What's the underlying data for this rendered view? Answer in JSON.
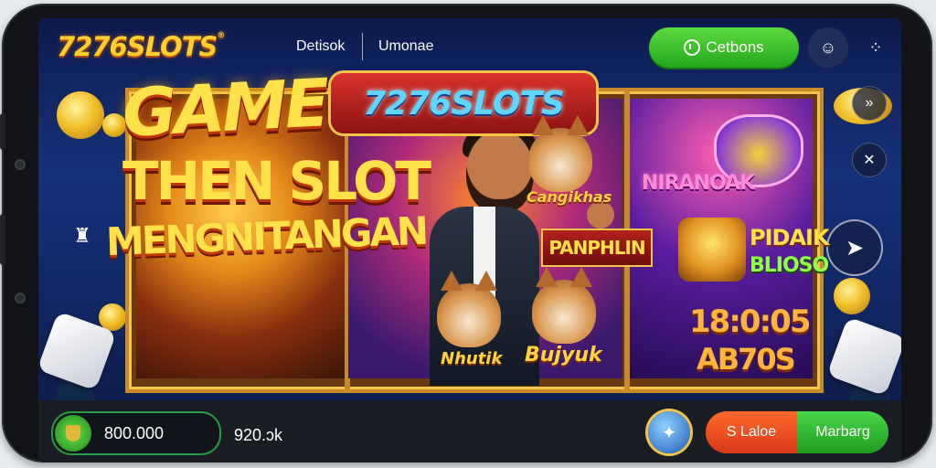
{
  "header": {
    "logo": "7276SLOTS",
    "logo_mark": "®",
    "nav": [
      "Detisok",
      "Umonae"
    ],
    "cta_label": "Cetbons",
    "icons": [
      "chat-icon",
      "grid-menu-icon"
    ]
  },
  "banner": {
    "logo": "7276SLOTS",
    "headline_line1": "GAME",
    "headline_line2": "THEN SLOT",
    "headline_line3": "MENGNITANGAN",
    "mid_cat_top_label": "Cangikhas",
    "mid_tag": "PANPHLIN",
    "mid_cat_left_label": "Nhutik",
    "mid_cat_right_label": "Bujyuk",
    "right_title": "NIRANOAK",
    "right_promo_line1": "PIDAIK",
    "right_promo_line2": "BLIOSO",
    "right_time": "18:0:05",
    "right_code": "AB70S"
  },
  "side_controls": {
    "top_icon": "double-chevron-icon",
    "second_icon": "crossed-tools-icon",
    "arrow_icon": "arrow-right-icon"
  },
  "bottom": {
    "balance": "800.000",
    "secondary_value": "920.ɔk",
    "action_left": "S Laloe",
    "action_right": "Marbarg"
  },
  "colors": {
    "accent_green": "#23a81c",
    "accent_orange": "#d8381a",
    "gold": "#ffe14a",
    "bg_navy": "#10255e"
  }
}
